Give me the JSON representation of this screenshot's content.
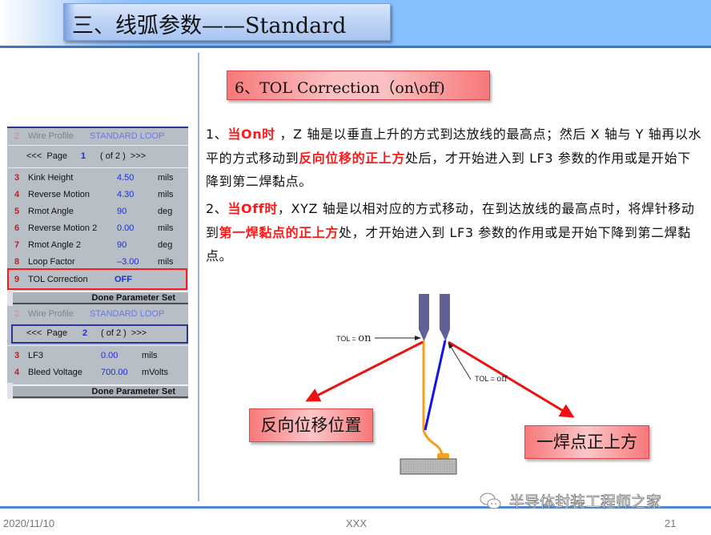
{
  "slide": {
    "title": "三、线弧参数——Standard",
    "subtitle": "6、TOL Correction（on\\off)"
  },
  "panel": {
    "page1": {
      "wire_profile": {
        "num": "2",
        "label": "Wire Profile",
        "value": "STANDARD LOOP"
      },
      "pager": {
        "prev": "<<<",
        "label": "Page",
        "page": "1",
        "of": "( of 2 )",
        "next": ">>>"
      },
      "rows": [
        {
          "num": "3",
          "label": "Kink Height",
          "value": "4.50",
          "unit": "mils"
        },
        {
          "num": "4",
          "label": "Reverse Motion",
          "value": "4.30",
          "unit": "mils"
        },
        {
          "num": "5",
          "label": "Rmot Angle",
          "value": "90",
          "unit": "deg"
        },
        {
          "num": "6",
          "label": "Reverse Motion 2",
          "value": "0.00",
          "unit": "mils"
        },
        {
          "num": "7",
          "label": "Rmot Angle 2",
          "value": "90",
          "unit": "deg"
        },
        {
          "num": "8",
          "label": "Loop Factor",
          "value": "–3.00",
          "unit": "mils"
        },
        {
          "num": "9",
          "label": "TOL Correction",
          "value": "OFF",
          "unit": ""
        }
      ],
      "done_label": "Done Parameter Set"
    },
    "page2": {
      "wire_profile": {
        "num": "2",
        "label": "Wire Profile",
        "value": "STANDARD LOOP"
      },
      "pager": {
        "prev": "<<<",
        "label": "Page",
        "page": "2",
        "of": "( of 2 )",
        "next": ">>>"
      },
      "rows": [
        {
          "num": "3",
          "label": "LF3",
          "value": "0.00",
          "unit": "mils"
        },
        {
          "num": "4",
          "label": "Bleed Voltage",
          "value": "700.00",
          "unit": "mVolts"
        }
      ],
      "done_label": "Done Parameter Set"
    }
  },
  "content": {
    "para1": {
      "prefix": "1、",
      "red1": "当On时",
      "text1": " ，Z 轴是以垂直上升的方式到达放线的最高点；然后 X 轴与 Y 轴再以水平的方式移动到",
      "red2": "反向位移的正上方",
      "text2": "处后，才开始进入到 LF3 参数的作用或是开始下降到第二焊黏点。"
    },
    "para2": {
      "prefix": "2、",
      "red1": "当Off时",
      "text1": "，XYZ 轴是以相对应的方式移动，在到达放线的最高点时，将焊针移动到",
      "red2": "第一焊黏点的正上方",
      "text2": "处，才开始进入到 LF3 参数的作用或是开始下降到第二焊黏点。"
    }
  },
  "diagram": {
    "tol_on_prefix": "TOL = ",
    "tol_on_value": "on",
    "tol_off_prefix": "TOL = ",
    "tol_off_value": "off",
    "left_box": "反向位移位置",
    "right_box": "一焊点正上方",
    "colors": {
      "capillary": "#616198",
      "wire_on": "#f5a01a",
      "wire_off": "#1414e6",
      "arrow": "#ee1111",
      "pad": "#b4b4b4"
    }
  },
  "footer": {
    "date": "2020/11/10",
    "center": "XXX",
    "page_number": "21",
    "watermark": "半导体封装工程师之家"
  }
}
